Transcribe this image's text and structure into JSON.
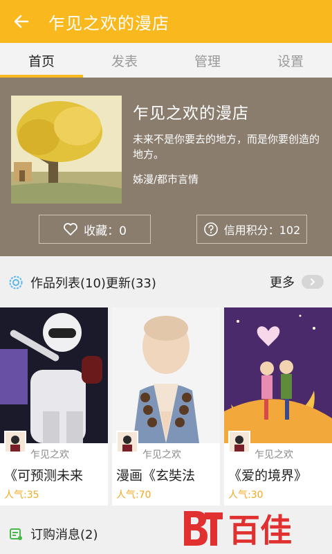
{
  "appbar": {
    "title": "乍见之欢的漫店",
    "back_icon": "arrow-left-icon"
  },
  "tabs": [
    {
      "label": "首页",
      "active": true
    },
    {
      "label": "发表",
      "active": false
    },
    {
      "label": "管理",
      "active": false
    },
    {
      "label": "设置",
      "active": false
    }
  ],
  "profile": {
    "name": "乍见之欢的漫店",
    "description": "未来不是你要去的地方，而是你要创造的地方。",
    "category": "姊漫/都市言情",
    "favorites_label": "收藏：0",
    "credit_label": "信用积分：102"
  },
  "works": {
    "title": "作品列表(10)更新(33)",
    "more_label": "更多",
    "items": [
      {
        "author": "乍见之欢",
        "title": "《可预测未来",
        "popularity": "人气:35"
      },
      {
        "author": "乍见之欢",
        "title": "漫画《玄奘法",
        "popularity": "人气:70"
      },
      {
        "author": "乍见之欢",
        "title": "《爱的境界》",
        "popularity": "人气:30"
      }
    ]
  },
  "orders": {
    "title": "订购消息(2)"
  },
  "watermark": {
    "text": "百佳"
  },
  "colors": {
    "accent": "#f9b81d",
    "profile_bg": "#8b7d6e",
    "popularity": "#f2a922",
    "watermark": "#e03030"
  }
}
